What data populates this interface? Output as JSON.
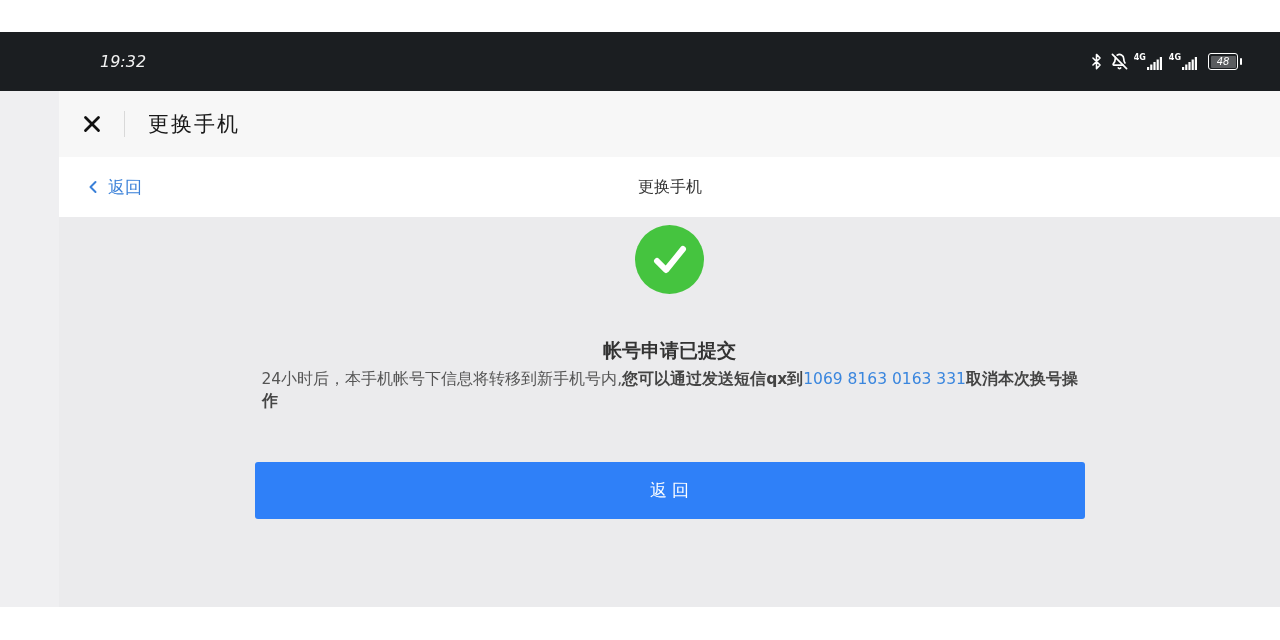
{
  "status_bar": {
    "time": "19:32",
    "networks": [
      {
        "label": "4G"
      },
      {
        "label": "4G"
      }
    ],
    "battery": "48"
  },
  "header": {
    "title": "更换手机"
  },
  "nav_bar": {
    "back_label": "返回",
    "title": "更换手机"
  },
  "result": {
    "kind": "success",
    "title": "帐号申请已提交",
    "description": {
      "text": "24小时后，本手机帐号下信息将转移到新手机号内,",
      "emphasis": "您可以通过发送短信qx到",
      "link": "1069 8163 0163 331",
      "emphasis_end": "取消本次换号操作"
    },
    "button": "返 回"
  }
}
